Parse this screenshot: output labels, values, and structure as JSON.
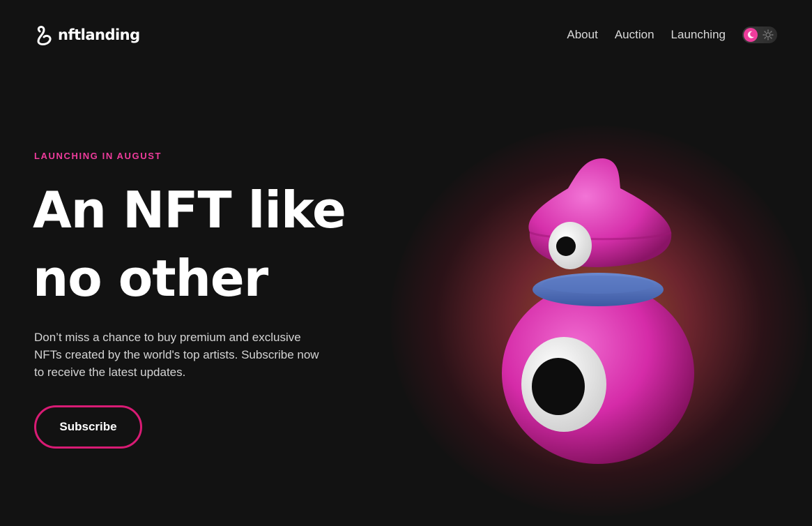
{
  "header": {
    "logo_text": "nftlanding",
    "nav": [
      {
        "label": "About"
      },
      {
        "label": "Auction"
      },
      {
        "label": "Launching"
      }
    ]
  },
  "hero": {
    "eyebrow": "LAUNCHING IN AUGUST",
    "headline": "An NFT like no other",
    "description": "Don’t miss a chance to buy premium and exclusive NFTs created by the world's top artists. Subscribe now to receive the latest updates.",
    "cta_label": "Subscribe"
  },
  "theme": {
    "accent": "#ee3c9c",
    "background": "#121212",
    "mode": "dark"
  }
}
